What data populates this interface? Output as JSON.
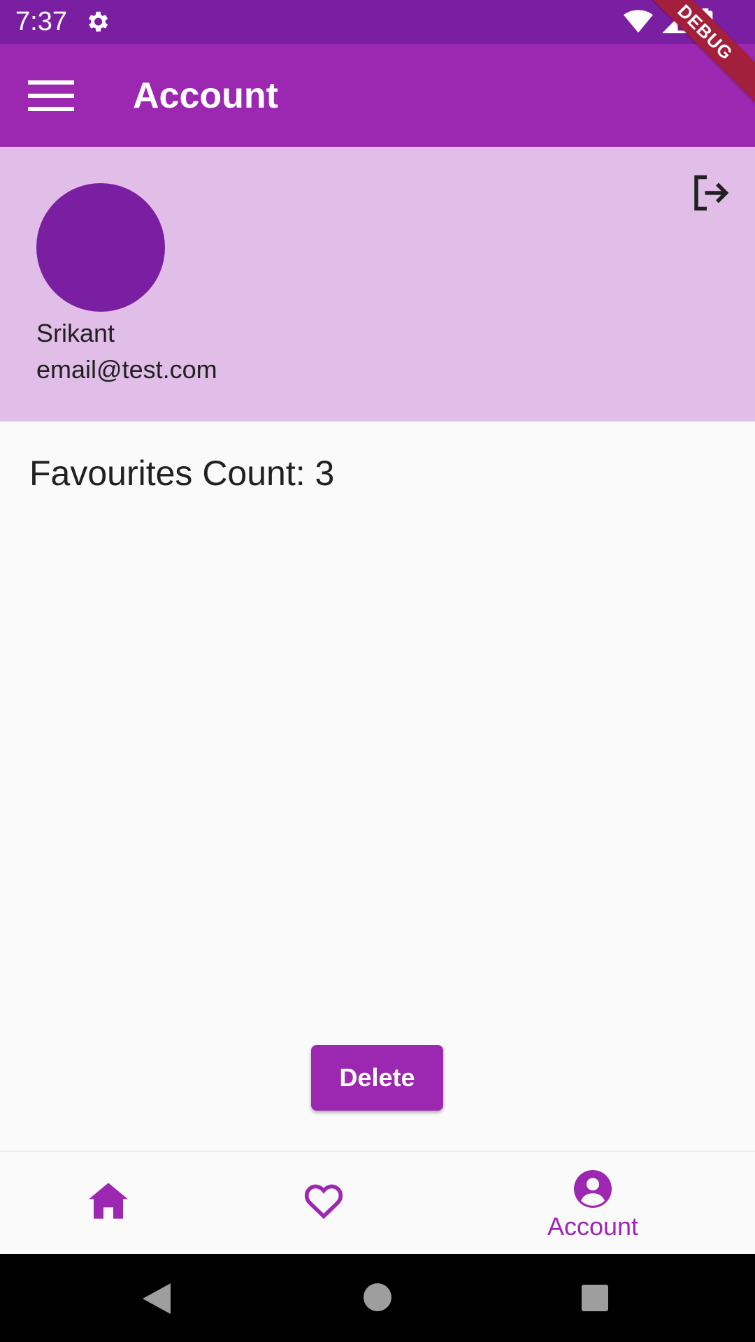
{
  "status_bar": {
    "time": "7:37",
    "debug_label": "DEBUG"
  },
  "app_bar": {
    "title": "Account"
  },
  "profile": {
    "name": "Srikant",
    "email": "email@test.com"
  },
  "main": {
    "favourites_label": "Favourites Count: 3"
  },
  "actions": {
    "delete_label": "Delete"
  },
  "bottom_nav": {
    "items": [
      {
        "icon": "home-icon",
        "label": ""
      },
      {
        "icon": "heart-outline-icon",
        "label": ""
      },
      {
        "icon": "account-circle-icon",
        "label": "Account",
        "selected": true
      }
    ]
  },
  "colors": {
    "primary": "#9c27b0",
    "primary_dark": "#7b1fa2",
    "header_bg": "#e1bee7",
    "debug_ribbon": "#a31f3c"
  }
}
